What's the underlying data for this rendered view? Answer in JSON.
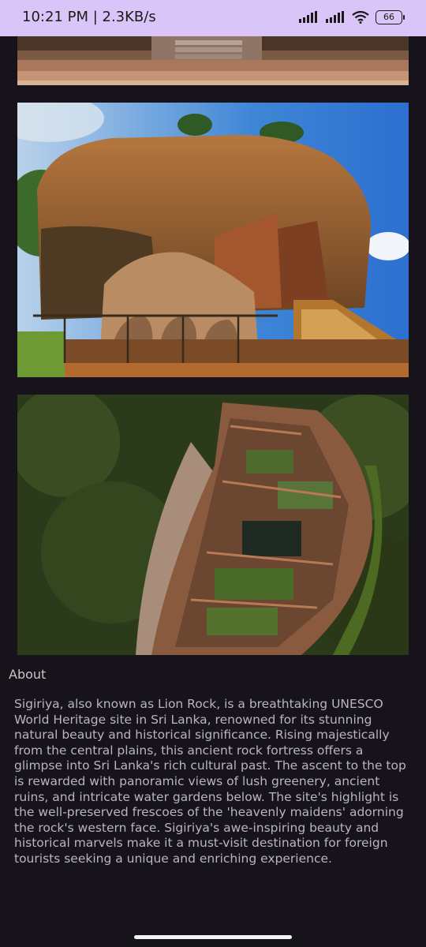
{
  "status_bar": {
    "time_speed": "10:21 PM | 2.3KB/s",
    "battery": "66",
    "icons": [
      "signal-icon",
      "signal-icon",
      "wifi-icon",
      "battery-icon"
    ]
  },
  "gallery": {
    "images": [
      {
        "name": "stone-steps-photo"
      },
      {
        "name": "lion-paws-photo"
      },
      {
        "name": "aerial-summit-photo"
      }
    ]
  },
  "about": {
    "heading": "About",
    "body": "Sigiriya, also known as Lion Rock, is a breathtaking UNESCO World Heritage site in Sri Lanka, renowned for its stunning natural beauty and historical significance. Rising majestically from the central plains, this ancient rock fortress offers a glimpse into Sri Lanka's rich cultural past. The ascent to the top is rewarded with panoramic views of lush greenery, ancient ruins, and intricate water gardens below. The site's highlight is the well-preserved frescoes of the 'heavenly maidens' adorning the rock's western face. Sigiriya's awe-inspiring beauty and historical marvels make it a must-visit destination for foreign tourists seeking a unique and enriching experience."
  }
}
